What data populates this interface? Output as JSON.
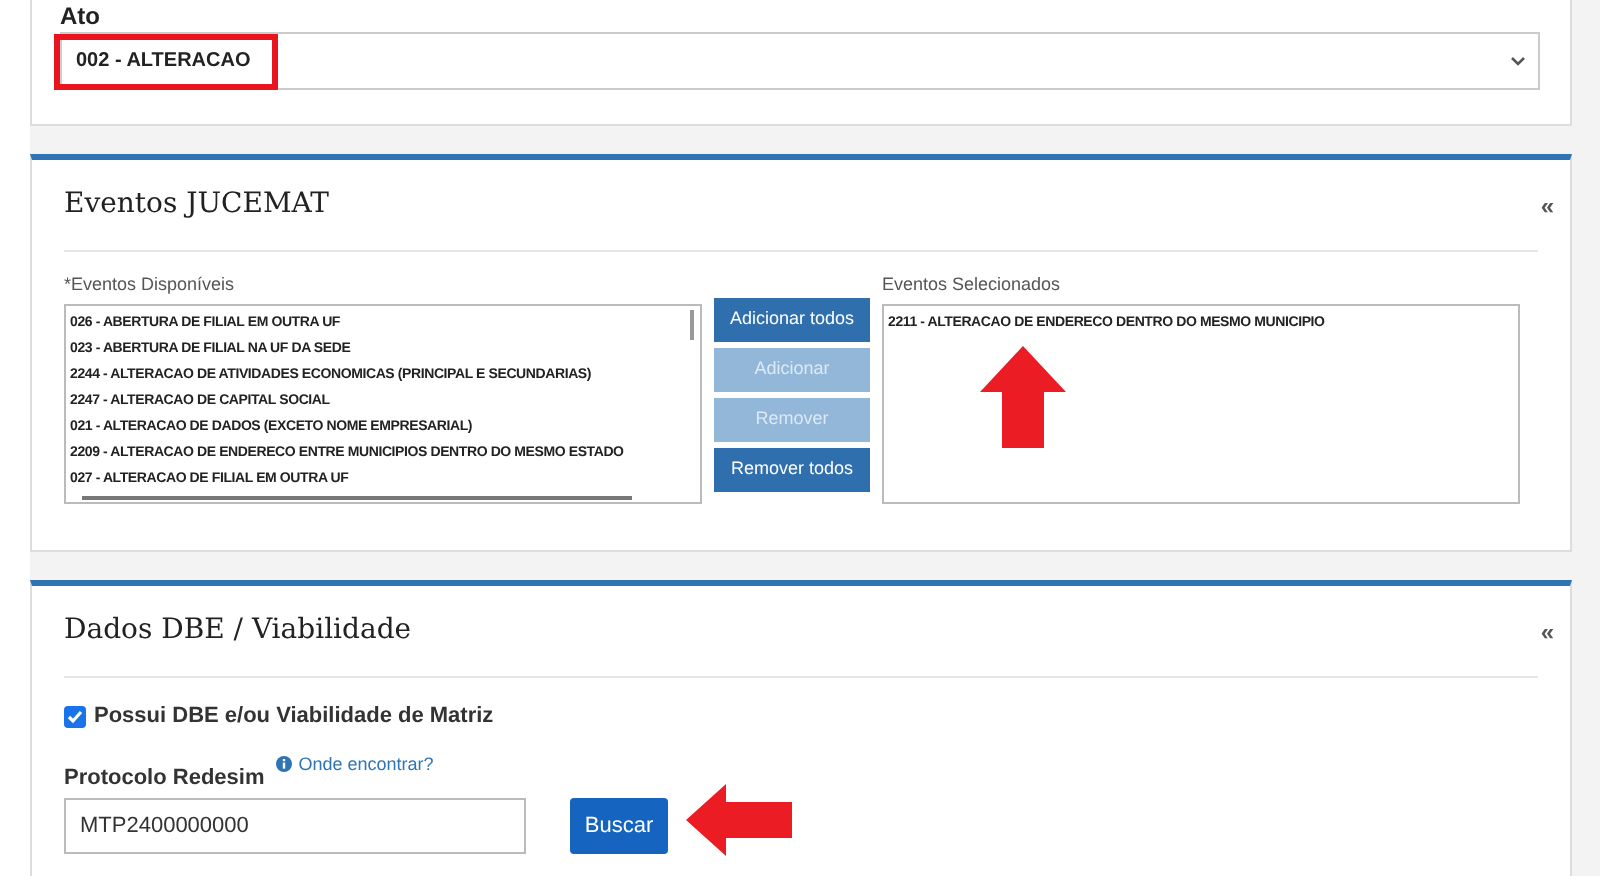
{
  "ato": {
    "label": "Ato",
    "value": "002 - ALTERACAO"
  },
  "eventos": {
    "title": "Eventos JUCEMAT",
    "collapse": "«",
    "available_label": "*Eventos Disponíveis",
    "selected_label": "Eventos Selecionados",
    "available": [
      {
        "label": "026 - ABERTURA DE FILIAL EM OUTRA UF"
      },
      {
        "label": "023 - ABERTURA DE FILIAL NA UF DA SEDE"
      },
      {
        "label": "2244 - ALTERACAO DE ATIVIDADES ECONOMICAS (PRINCIPAL E SECUNDARIAS)"
      },
      {
        "label": "2247 - ALTERACAO DE CAPITAL SOCIAL"
      },
      {
        "label": "021 - ALTERACAO DE DADOS (EXCETO NOME EMPRESARIAL)"
      },
      {
        "label": "2209 - ALTERACAO DE ENDERECO ENTRE MUNICIPIOS DENTRO DO MESMO ESTADO"
      },
      {
        "label": "027 - ALTERACAO DE FILIAL EM OUTRA UF"
      }
    ],
    "buttons": [
      {
        "label": "Adicionar todos",
        "disabled": false
      },
      {
        "label": "Adicionar",
        "disabled": true
      },
      {
        "label": "Remover",
        "disabled": true
      },
      {
        "label": "Remover todos",
        "disabled": false
      }
    ],
    "selected": [
      {
        "label": "2211 - ALTERACAO DE ENDERECO DENTRO DO MESMO MUNICIPIO"
      }
    ]
  },
  "dbe": {
    "title": "Dados DBE / Viabilidade",
    "collapse": "«",
    "checkbox": {
      "label": "Possui DBE e/ou Viabilidade de Matriz",
      "checked": true
    },
    "protocolo_label": "Protocolo Redesim",
    "help_link": "Onde encontrar?",
    "protocolo_value": "MTP2400000000",
    "search_button": "Buscar"
  }
}
